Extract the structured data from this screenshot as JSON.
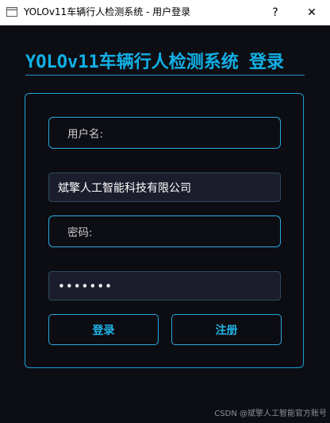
{
  "window": {
    "title": "YOLOv11车辆行人检测系统 - 用户登录",
    "help_label": "?",
    "close_label": "✕"
  },
  "main": {
    "heading": "YOLOv11车辆行人检测系统 登录",
    "username_label": "用户名:",
    "username_value": "斌擎人工智能科技有限公司",
    "password_label": "密码:",
    "password_value": "1234567",
    "login_label": "登录",
    "register_label": "注册"
  },
  "watermark": "CSDN @斌擎人工智能官方账号",
  "colors": {
    "accent": "#11b0e6",
    "background": "#0d0e14",
    "field_bg": "#1c1d2c"
  }
}
